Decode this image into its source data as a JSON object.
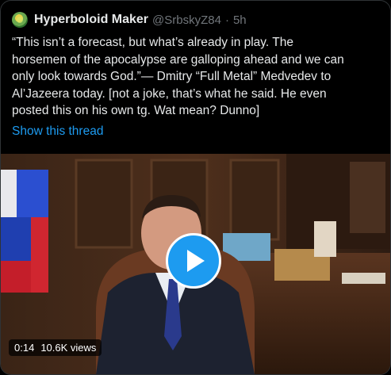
{
  "tweet": {
    "author_name": "Hyperboloid Maker",
    "author_handle": "@SrbskyZ84",
    "separator": "·",
    "time": "5h",
    "text": "“This isn’t a forecast, but what’s already in play. The\nhorsemen of the apocalypse are galloping ahead and we can\nonly look towards God.”— Dmitry “Full Metal” Medvedev to\nAl’Jazeera today. [not a joke, that’s what he said. He even\nposted this on his own tg. Wat mean? Dunno]",
    "thread_link": "Show this thread"
  },
  "video": {
    "elapsed": "0:14",
    "views": "10.6K views",
    "play_icon": "play-icon"
  },
  "colors": {
    "background": "#000000",
    "text": "#e7e9ea",
    "muted": "#71767b",
    "accent": "#1d9bf0",
    "border": "#2f3336"
  }
}
